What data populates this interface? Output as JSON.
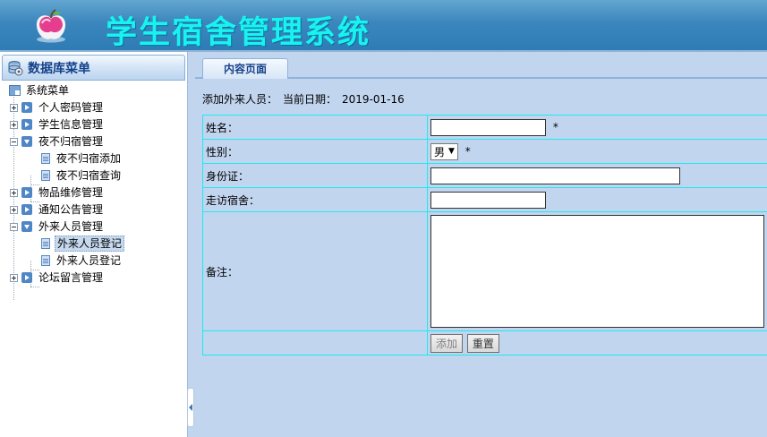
{
  "header": {
    "title": "学生宿舍管理系统",
    "logo": "apple-logo-icon",
    "accent": "#19f3f0"
  },
  "sidebar": {
    "title": "数据库菜单",
    "root": "系统菜单",
    "items": [
      {
        "label": "个人密码管理"
      },
      {
        "label": "学生信息管理"
      },
      {
        "label": "夜不归宿管理",
        "children": [
          {
            "label": "夜不归宿添加"
          },
          {
            "label": "夜不归宿查询"
          }
        ]
      },
      {
        "label": "物品维修管理"
      },
      {
        "label": "通知公告管理"
      },
      {
        "label": "外来人员管理",
        "children": [
          {
            "label": "外来人员登记",
            "selected": true
          },
          {
            "label": "外来人员登记"
          }
        ]
      },
      {
        "label": "论坛留言管理"
      }
    ]
  },
  "tabs": [
    {
      "label": "内容页面"
    }
  ],
  "page": {
    "heading": "添加外来人员：",
    "date_label": "当前日期：",
    "date": "2019-01-16"
  },
  "form": {
    "name_label": "姓名：",
    "gender_label": "性别：",
    "gender_value": "男",
    "idcard_label": "身份证：",
    "dorm_label": "走访宿舍：",
    "remark_label": "备注：",
    "required_mark": "*",
    "submit_label": "添加",
    "reset_label": "重置"
  }
}
